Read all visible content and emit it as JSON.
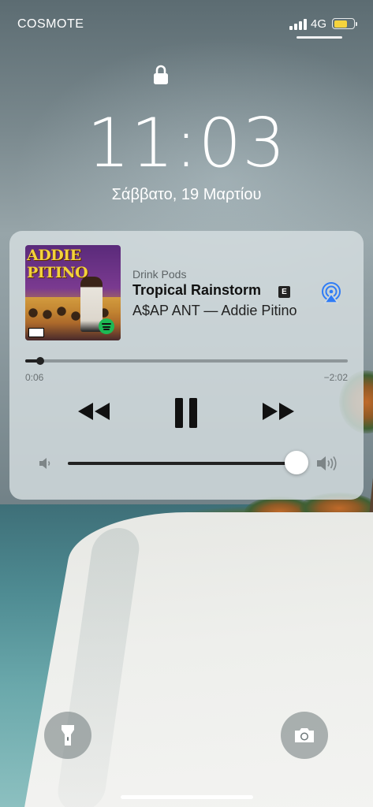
{
  "status_bar": {
    "carrier": "COSMOTE",
    "network": "4G",
    "battery_level_percent": 68,
    "battery_color": "#f5d33d",
    "signal_bars": 4
  },
  "lock_screen": {
    "lock_icon": "lock-icon",
    "time": "11:03",
    "date": "Σάββατο, 19 Μαρτίου"
  },
  "now_playing": {
    "artwork": {
      "title_text": "ADDIE PITINO",
      "badge_icon": "spotify-icon"
    },
    "source": "Drink Pods",
    "title": "Tropical Rainstorm",
    "explicit_label": "E",
    "subtitle": "A$AP ANT — Addie Pitino",
    "airplay_icon": "airplay-icon",
    "elapsed": "0:06",
    "remaining": "−2:02",
    "progress_fraction": 0.047,
    "controls": {
      "rewind_icon": "rewind-icon",
      "pause_icon": "pause-icon",
      "forward_icon": "fast-forward-icon"
    },
    "volume_fraction": 1.0,
    "volume_low_icon": "speaker-low-icon",
    "volume_high_icon": "speaker-high-icon"
  },
  "bottom": {
    "flashlight_icon": "flashlight-icon",
    "camera_icon": "camera-icon"
  }
}
